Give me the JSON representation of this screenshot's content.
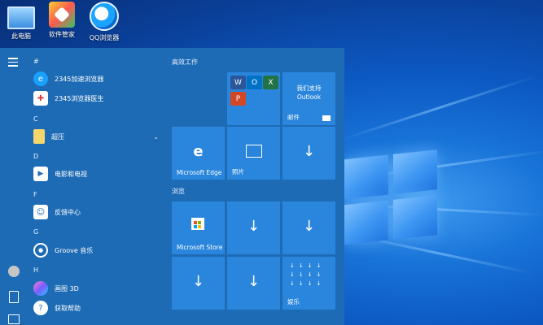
{
  "desktop": {
    "icons": [
      {
        "label": "此电脑",
        "icon": "computer-icon"
      },
      {
        "label": "软件管家",
        "icon": "software-manager-icon"
      },
      {
        "label": "QQ浏览器",
        "icon": "qq-browser-icon"
      }
    ]
  },
  "start_menu": {
    "sections": [
      {
        "letter": "#"
      },
      {
        "letter": "C"
      },
      {
        "letter": "D"
      },
      {
        "letter": "F"
      },
      {
        "letter": "G"
      },
      {
        "letter": "H"
      }
    ],
    "apps": [
      {
        "label": "2345加速浏览器",
        "icon": "browser-2345-icon"
      },
      {
        "label": "2345浏览器医生",
        "icon": "browser-doctor-icon"
      },
      {
        "label": "超压",
        "icon": "folder-icon"
      },
      {
        "label": "电影和电视",
        "icon": "movies-tv-icon"
      },
      {
        "label": "反馈中心",
        "icon": "feedback-hub-icon"
      },
      {
        "label": "Groove 音乐",
        "icon": "groove-music-icon"
      },
      {
        "label": "画图 3D",
        "icon": "paint-3d-icon"
      },
      {
        "label": "获取帮助",
        "icon": "get-help-icon"
      }
    ],
    "tile_groups": [
      {
        "title": "高效工作"
      },
      {
        "title": "浏览"
      }
    ],
    "tiles": {
      "outlook_text": "我们支持 Outlook",
      "mail": "邮件",
      "edge": "Microsoft Edge",
      "photos": "照片",
      "store": "Microsoft Store",
      "entertainment": "娱乐"
    }
  },
  "colors": {
    "menu_bg": "#1e6bb5",
    "tile_bg": "#2a86dc"
  }
}
